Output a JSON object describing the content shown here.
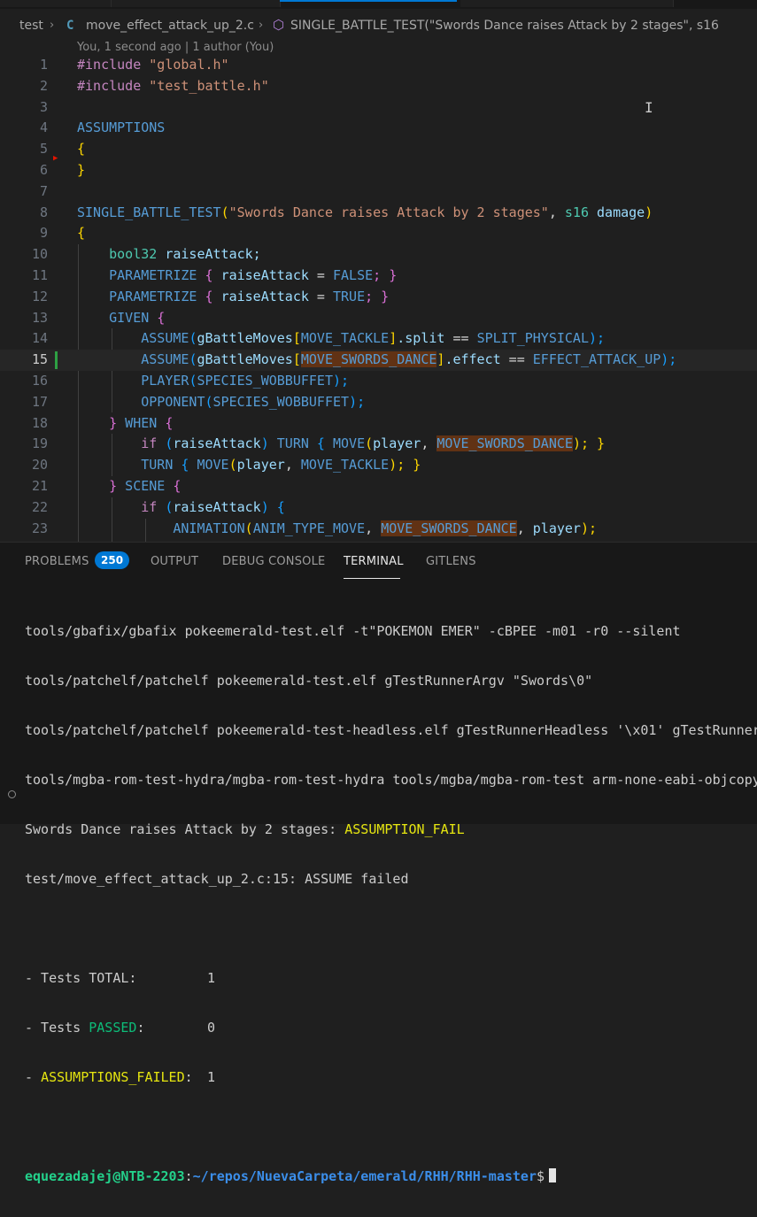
{
  "breadcrumb": {
    "folder": "test",
    "file_icon": "C",
    "file": "move_effect_attack_up_2.c",
    "symbol_icon": "symbol-cube-icon",
    "symbol": "SINGLE_BATTLE_TEST(\"Swords Dance raises Attack by 2 stages\", s16"
  },
  "blame": "You, 1 second ago | 1 author (You)",
  "line_numbers": [
    "1",
    "2",
    "3",
    "4",
    "5",
    "6",
    "7",
    "8",
    "9",
    "10",
    "11",
    "12",
    "13",
    "14",
    "15",
    "16",
    "17",
    "18",
    "19",
    "20",
    "21",
    "22",
    "23"
  ],
  "code": {
    "l1": {
      "a": "#include ",
      "b": "\"global.h\""
    },
    "l2": {
      "a": "#include ",
      "b": "\"test_battle.h\""
    },
    "l4": "ASSUMPTIONS",
    "l5": "{",
    "l6": "}",
    "l8": {
      "a": "SINGLE_BATTLE_TEST",
      "b": "(",
      "c": "\"Swords Dance raises Attack by 2 stages\"",
      "d": ", ",
      "e": "s16",
      "f": " ",
      "g": "damage",
      "h": ")"
    },
    "l9": "{",
    "l10": {
      "a": "bool32",
      "b": " raiseAttack;"
    },
    "l11": {
      "a": "PARAMETRIZE",
      "b": " { ",
      "c": "raiseAttack",
      "d": " = ",
      "e": "FALSE",
      "f": "; }"
    },
    "l12": {
      "a": "PARAMETRIZE",
      "b": " { ",
      "c": "raiseAttack",
      "d": " = ",
      "e": "TRUE",
      "f": "; }"
    },
    "l13": {
      "a": "GIVEN",
      "b": " {"
    },
    "l14": {
      "a": "ASSUME",
      "b": "(",
      "c": "gBattleMoves",
      "d": "[",
      "e": "MOVE_TACKLE",
      "f": "]",
      "g": ".split",
      "h": " == ",
      "i": "SPLIT_PHYSICAL",
      "j": ");"
    },
    "l15": {
      "a": "ASSUME",
      "b": "(",
      "c": "gBattleMoves",
      "d": "[",
      "e": "MOVE_SWORDS_DANCE",
      "f": "]",
      "g": ".effect",
      "h": " == ",
      "i": "EFFECT_ATTACK_UP",
      "j": ");"
    },
    "l16": {
      "a": "PLAYER",
      "b": "(",
      "c": "SPECIES_WOBBUFFET",
      "d": ");"
    },
    "l17": {
      "a": "OPPONENT",
      "b": "(",
      "c": "SPECIES_WOBBUFFET",
      "d": ");"
    },
    "l18": {
      "a": "}",
      "b": " WHEN",
      "c": " {"
    },
    "l19": {
      "a": "if",
      "b": " (",
      "c": "raiseAttack",
      "d": ") ",
      "e": "TURN",
      "f": " { ",
      "g": "MOVE",
      "h": "(",
      "i": "player",
      "j": ", ",
      "k": "MOVE_SWORDS_DANCE",
      "l": "); }"
    },
    "l20": {
      "a": "TURN",
      "b": " { ",
      "c": "MOVE",
      "d": "(",
      "e": "player",
      "f": ", ",
      "g": "MOVE_TACKLE",
      "h": "); }"
    },
    "l21": {
      "a": "}",
      "b": " SCENE",
      "c": " {"
    },
    "l22": {
      "a": "if",
      "b": " (",
      "c": "raiseAttack",
      "d": ") {"
    },
    "l23": {
      "a": "ANIMATION",
      "b": "(",
      "c": "ANIM_TYPE_MOVE",
      "d": ", ",
      "e": "MOVE_SWORDS_DANCE",
      "f": ", ",
      "g": "player",
      "h": ");"
    }
  },
  "panel": {
    "tabs": [
      "PROBLEMS",
      "OUTPUT",
      "DEBUG CONSOLE",
      "TERMINAL",
      "GITLENS"
    ],
    "problems_count": "250",
    "active_tab": "TERMINAL"
  },
  "terminal": {
    "lines": [
      "tools/gbafix/gbafix pokeemerald-test.elf -t\"POKEMON EMER\" -cBPEE -m01 -r0 --silent",
      "tools/patchelf/patchelf pokeemerald-test.elf gTestRunnerArgv \"Swords\\0\"",
      "tools/patchelf/patchelf pokeemerald-test-headless.elf gTestRunnerHeadless '\\x01' gTestRunner",
      "tools/mgba-rom-test-hydra/mgba-rom-test-hydra tools/mgba/mgba-rom-test arm-none-eabi-objcopy"
    ],
    "assume_prefix": "Swords Dance raises Attack by 2 stages: ",
    "assume_status": "ASSUMPTION_FAIL",
    "failed_line": "test/move_effect_attack_up_2.c:15: ASSUME failed",
    "total_label": "- Tests TOTAL:",
    "total_value": "1",
    "passed_prefix": "- Tests ",
    "passed_word": "PASSED",
    "passed_suffix": ":",
    "passed_value": "0",
    "assump_prefix": "- ",
    "assump_word": "ASSUMPTIONS_FAILED",
    "assump_suffix": ":",
    "assump_value": "1",
    "prompt_user": "equezadajej@NTB-2203",
    "prompt_colon": ":",
    "prompt_path": "~/repos/NuevaCarpeta/emerald/RHH/RHH-master",
    "prompt_symbol": "$"
  }
}
